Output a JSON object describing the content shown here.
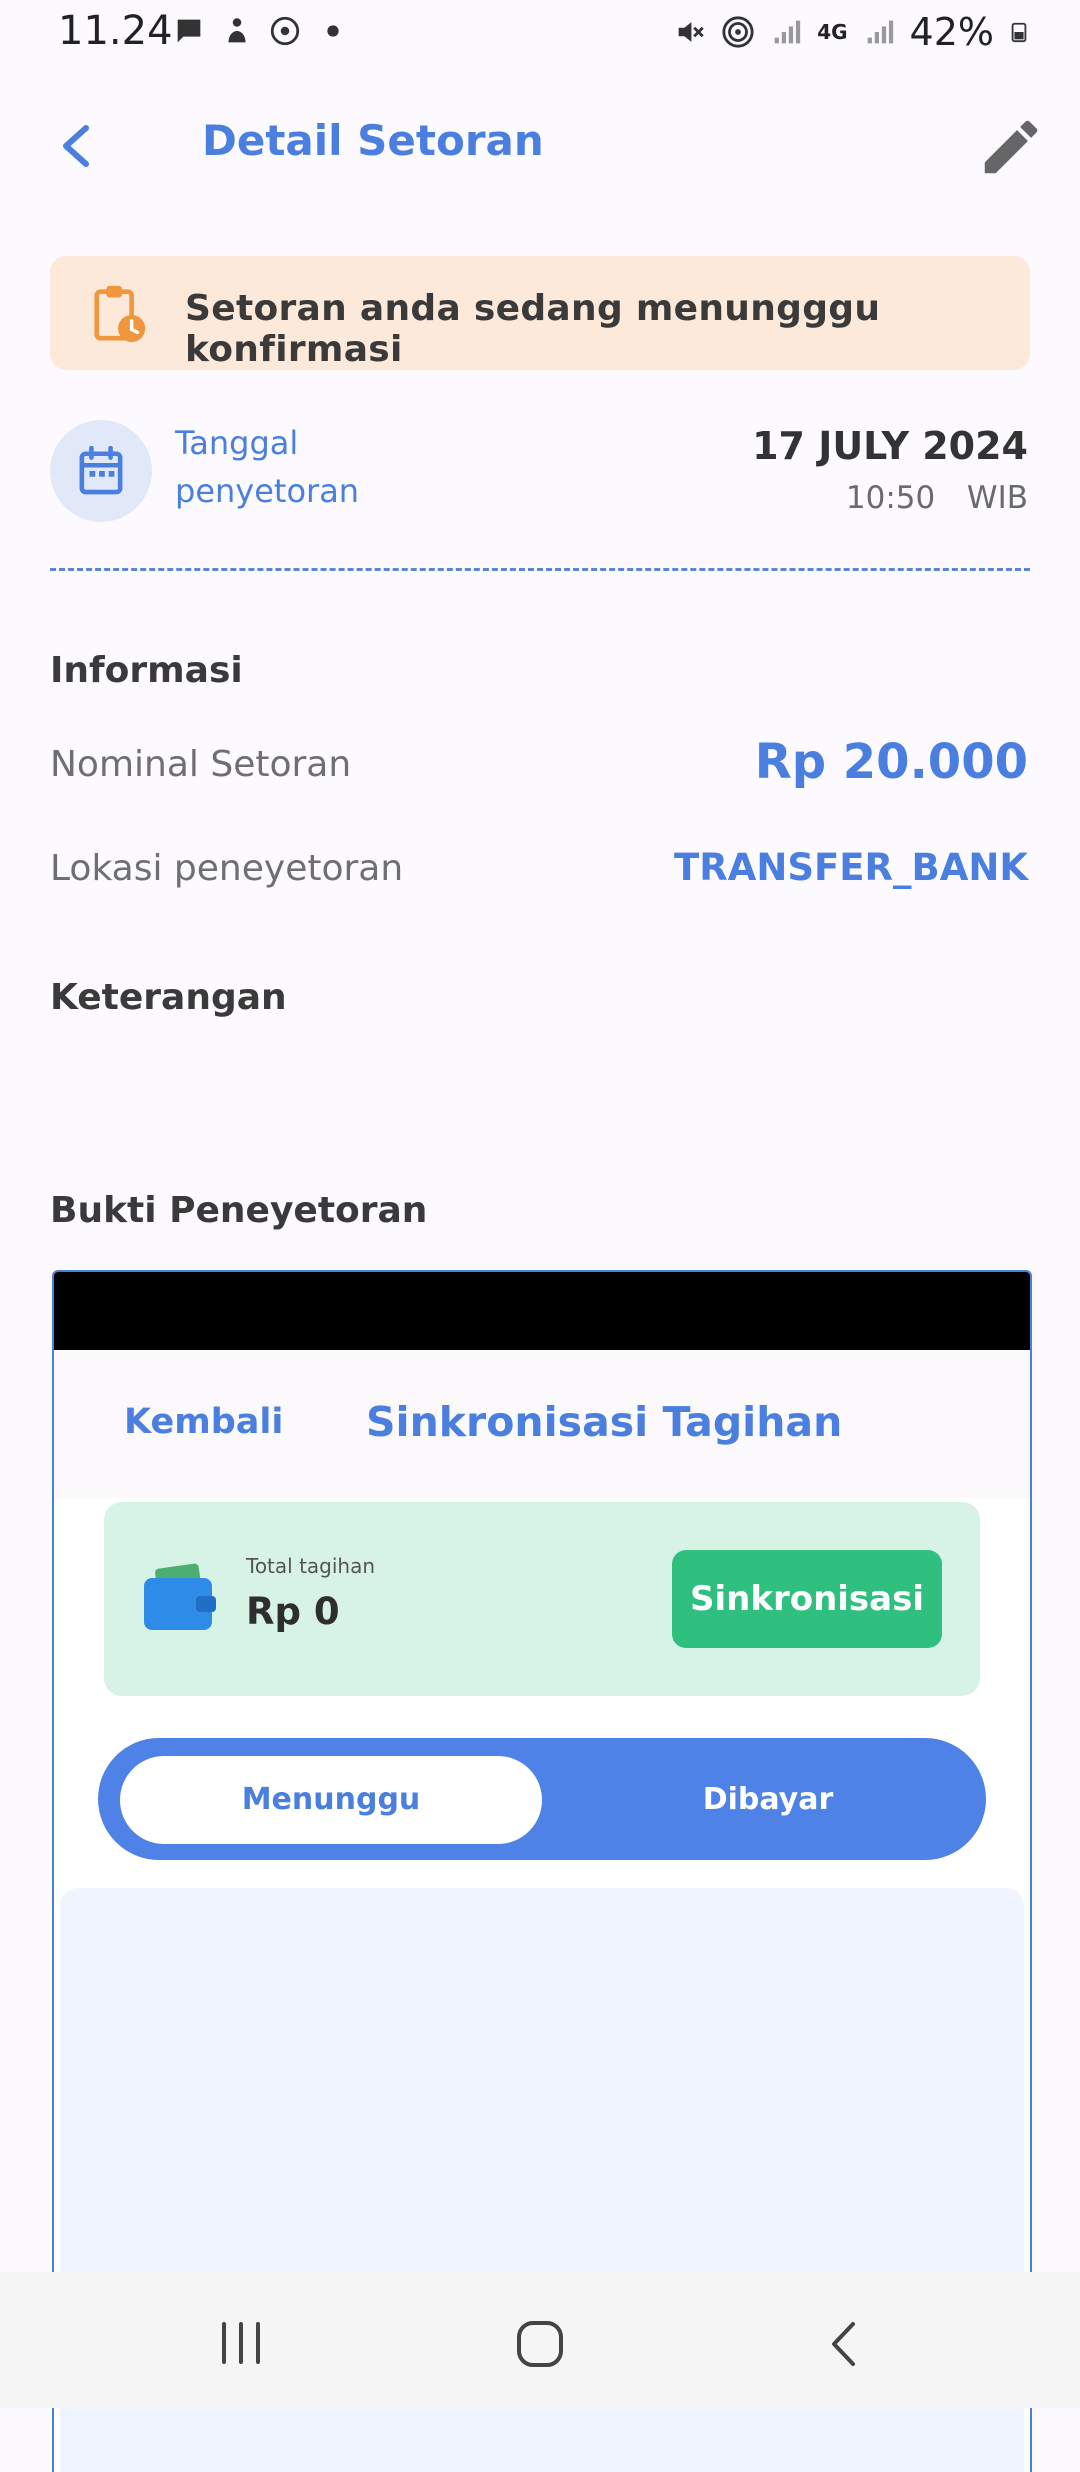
{
  "status_bar": {
    "time": "11.24",
    "battery": "42%",
    "network": "4G"
  },
  "header": {
    "title": "Detail Setoran"
  },
  "banner": {
    "message": "Setoran anda sedang menungggu konfirmasi"
  },
  "deposit_date": {
    "label_line1": "Tanggal",
    "label_line2": "penyetoran",
    "date": "17 JULY 2024",
    "time": "10:50  WIB"
  },
  "info": {
    "section_title": "Informasi",
    "nominal_label": "Nominal Setoran",
    "nominal_value": "Rp 20.000",
    "location_label": "Lokasi peneyetoran",
    "location_value": "TRANSFER_BANK"
  },
  "notes": {
    "section_title": "Keterangan"
  },
  "proof": {
    "section_title": "Bukti Peneyetoran",
    "screenshot": {
      "back_label": "Kembali",
      "title": "Sinkronisasi Tagihan",
      "total_label": "Total tagihan",
      "total_value": "Rp 0",
      "sync_button": "Sinkronisasi",
      "tab_waiting": "Menunggu",
      "tab_paid": "Dibayar"
    }
  },
  "colors": {
    "accent": "#4a7fe0",
    "banner_bg": "#fde9da",
    "banner_icon": "#f0963c",
    "green": "#2fbf7f"
  },
  "icons": {
    "back": "chevron-left-icon",
    "edit": "pencil-icon",
    "banner": "clipboard-clock-icon",
    "date": "calendar-icon"
  }
}
